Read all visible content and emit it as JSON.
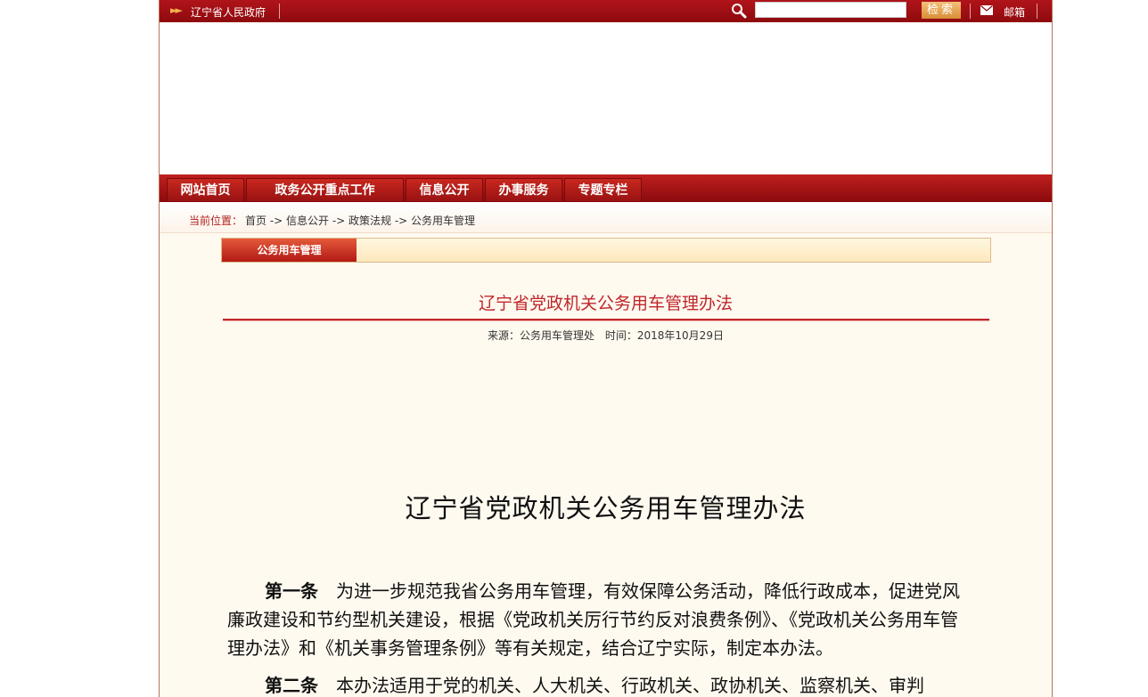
{
  "topbar": {
    "site_name": "辽宁省人民政府",
    "search_placeholder": "",
    "search_button": "检索",
    "mail_label": "邮箱"
  },
  "nav": {
    "items": [
      {
        "label": "网站首页"
      },
      {
        "label": "政务公开重点工作"
      },
      {
        "label": "信息公开"
      },
      {
        "label": "办事服务"
      },
      {
        "label": "专题专栏"
      }
    ]
  },
  "breadcrumb": {
    "label": "当前位置：",
    "path": "首页 -> 信息公开 -> 政策法规 -> 公务用车管理"
  },
  "section": {
    "tag": "公务用车管理"
  },
  "article": {
    "title": "辽宁省党政机关公务用车管理办法",
    "source": "来源：公务用车管理处",
    "time": "时间：2018年10月29日",
    "doc_title": "辽宁省党政机关公务用车管理办法",
    "para1_head": "第一条",
    "para1_text": "为进一步规范我省公务用车管理，有效保障公务活动，降低行政成本，促进党风廉政建设和节约型机关建设，根据《党政机关厉行节约反对浪费条例》、《党政机关公务用车管理办法》和《机关事务管理条例》等有关规定，结合辽宁实际，制定本办法。",
    "para2_head": "第二条",
    "para2_text": "本办法适用于党的机关、人大机关、行政机关、政协机关、监察机关、审判"
  }
}
